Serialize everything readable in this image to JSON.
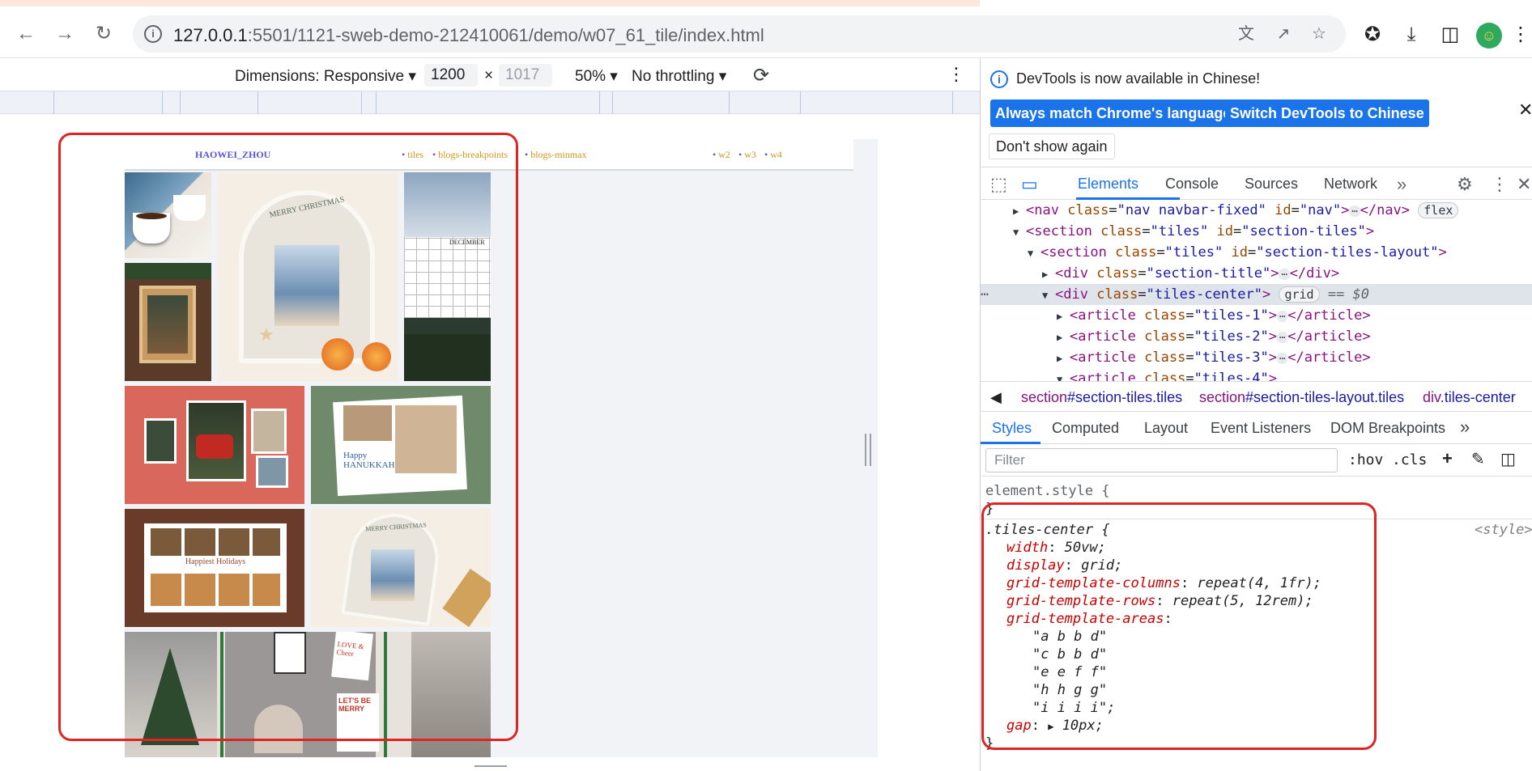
{
  "browser": {
    "url_host": "127.0.0.1",
    "url_rest": ":5501/1121-sweb-demo-212410061/demo/w07_61_tile/index.html"
  },
  "device_toolbar": {
    "dimensions_label": "Dimensions: Responsive",
    "width_value": "1200",
    "height_value": "1017",
    "times": "×",
    "zoom": "50%",
    "throttling": "No throttling"
  },
  "site": {
    "brand": "HAOWEI_ZHOU",
    "links": [
      "tiles",
      "blogs-breakpoints",
      "blogs-minmax",
      "w2",
      "w3",
      "w4"
    ]
  },
  "tile_text": {
    "calendar_month": "DECEMBER",
    "card1_greeting": "MERRY CHRISTMAS",
    "card2_greeting": "Happy HANUKKAH",
    "card3_greeting": "Happiest Holidays",
    "card4_greeting": "MERRY CHRISTMAS",
    "card5a": "LOVE & Cheer",
    "card5b": "LET'S BE MERRY"
  },
  "devtools": {
    "info_message": "DevTools is now available in Chinese!",
    "btn_match": "Always match Chrome's language",
    "btn_switch": "Switch DevTools to Chinese",
    "btn_dont_show": "Don't show again",
    "main_tabs": [
      "Elements",
      "Console",
      "Sources",
      "Network"
    ],
    "dom": {
      "nav_line": {
        "tag": "nav",
        "class_attr": "nav navbar-fixed",
        "id_attr": "nav",
        "badge": "flex"
      },
      "section1": {
        "tag": "section",
        "class_attr": "tiles",
        "id_attr": "section-tiles"
      },
      "section2": {
        "tag": "section",
        "class_attr": "tiles",
        "id_attr": "section-tiles-layout"
      },
      "div_title": {
        "class_attr": "section-title"
      },
      "div_center": {
        "class_attr": "tiles-center",
        "badge": "grid",
        "eq": "== $0"
      },
      "articles": [
        "tiles-1",
        "tiles-2",
        "tiles-3",
        "tiles-4"
      ]
    },
    "breadcrumbs": [
      {
        "tag": "section",
        "rest": "#section-tiles.tiles"
      },
      {
        "tag": "section",
        "rest": "#section-tiles-layout.tiles"
      },
      {
        "tag": "div",
        "rest": ".tiles-center"
      }
    ],
    "sub_tabs": [
      "Styles",
      "Computed",
      "Layout",
      "Event Listeners",
      "DOM Breakpoints"
    ],
    "filter_placeholder": "Filter",
    "hov": ":hov",
    "cls": ".cls",
    "element_style_open": "element.style {",
    "element_style_close": "}",
    "rule": {
      "selector": ".tiles-center {",
      "source": "<style>",
      "props": [
        {
          "name": "width",
          "value": "50vw;"
        },
        {
          "name": "display",
          "value": "grid;"
        },
        {
          "name": "grid-template-columns",
          "value": "repeat(4, 1fr);"
        },
        {
          "name": "grid-template-rows",
          "value": "repeat(5, 12rem);"
        },
        {
          "name": "grid-template-areas",
          "value": ""
        }
      ],
      "areas": [
        "\"a b b d\"",
        "\"c b b d\"",
        "\"e e f f\"",
        "\"h h g g\"",
        "\"i i i i\";"
      ],
      "gap_name": "gap",
      "gap_value": "10px;",
      "close": "}"
    }
  },
  "colors": {
    "highlight_red": "#e02424",
    "devtools_blue": "#1a73e8",
    "brand_purple": "#5a54e0",
    "link_gold": "#c99a1e"
  }
}
